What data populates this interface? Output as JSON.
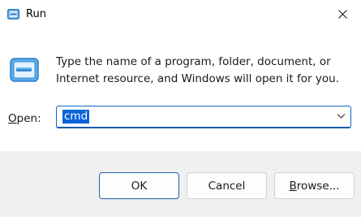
{
  "window": {
    "title": "Run",
    "title_icon": "run-icon",
    "close_icon": "close-icon"
  },
  "body": {
    "icon": "run-icon",
    "description": "Type the name of a program, folder, document, or Internet resource, and Windows will open it for you.",
    "open_label": "Open:",
    "open_label_mnemonic": "O",
    "open_label_rest": "pen:",
    "open_value": "cmd"
  },
  "footer": {
    "ok_label": "OK",
    "cancel_label": "Cancel",
    "browse_label": "Browse...",
    "browse_mnemonic": "B",
    "browse_rest": "rowse..."
  },
  "colors": {
    "accent": "#0f67c0",
    "selection": "#0a64d8",
    "footer_bg": "#f0f0f0"
  }
}
